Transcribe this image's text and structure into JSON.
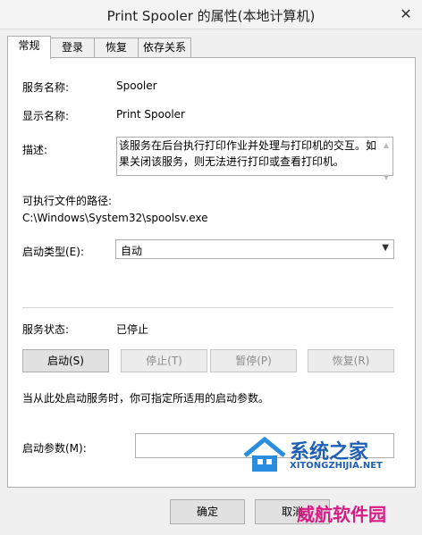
{
  "window": {
    "title": "Print Spooler 的属性(本地计算机)",
    "close_glyph": "✕"
  },
  "tabs": [
    "常规",
    "登录",
    "恢复",
    "依存关系"
  ],
  "general": {
    "service_name_label": "服务名称:",
    "service_name": "Spooler",
    "display_name_label": "显示名称:",
    "display_name": "Print Spooler",
    "description_label": "描述:",
    "description": "该服务在后台执行打印作业并处理与打印机的交互。如果关闭该服务，则无法进行打印或查看打印机。",
    "exe_path_label": "可执行文件的路径:",
    "exe_path": "C:\\Windows\\System32\\spoolsv.exe",
    "startup_type_label": "启动类型(E):",
    "startup_type": "自动",
    "status_label": "服务状态:",
    "status": "已停止",
    "buttons": {
      "start": "启动(S)",
      "stop": "停止(T)",
      "pause": "暂停(P)",
      "resume": "恢复(R)"
    },
    "hint": "当从此处启动服务时，你可指定所适用的启动参数。",
    "param_label": "启动参数(M):",
    "param_value": ""
  },
  "footer": {
    "ok": "确定",
    "cancel": "取消"
  },
  "watermarks": {
    "site_cn": "系统之家",
    "site_url": "XITONGZHIJIA.NET",
    "brand": "威航软件园"
  }
}
